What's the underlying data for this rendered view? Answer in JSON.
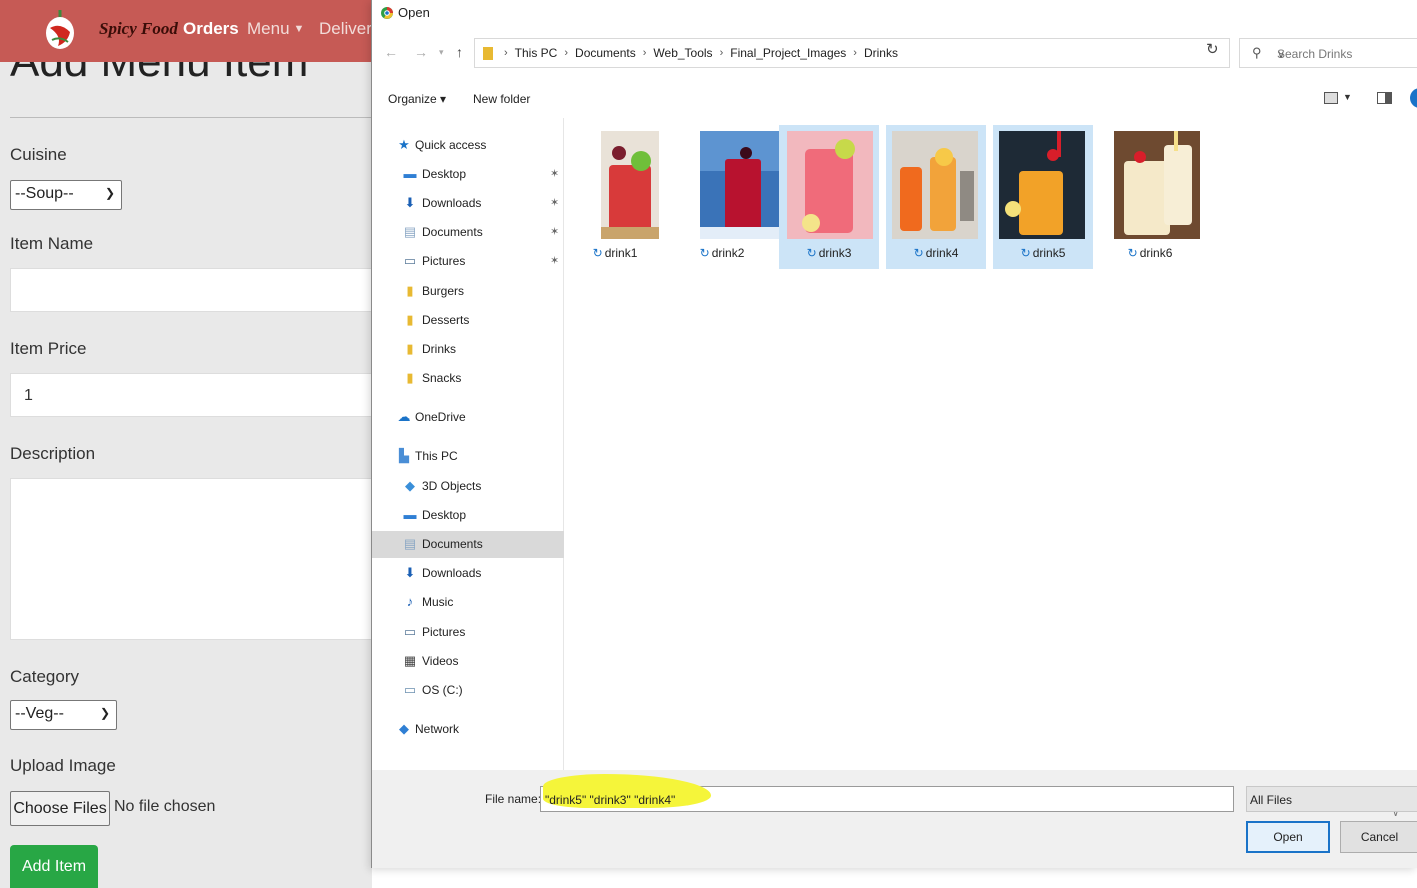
{
  "webpage": {
    "brand": "Spicy Food",
    "nav_orders": "Orders",
    "nav_menu": "Menu",
    "nav_delivery": "Delivery",
    "page_title": "Add Menu Item",
    "cuisine_label": "Cuisine",
    "cuisine_value": "--Soup--",
    "item_name_label": "Item Name",
    "item_name_value": "",
    "item_price_label": "Item Price",
    "item_price_value": "1",
    "description_label": "Description",
    "description_value": "",
    "category_label": "Category",
    "category_value": "--Veg--",
    "upload_label": "Upload Image",
    "choose_files": "Choose Files",
    "no_file": "No file chosen",
    "add_item": "Add Item",
    "colors": {
      "navbar": "#c65a55",
      "add_button": "#28a745"
    }
  },
  "dialog": {
    "title": "Open",
    "breadcrumb": [
      "This PC",
      "Documents",
      "Web_Tools",
      "Final_Project_Images",
      "Drinks"
    ],
    "search_placeholder": "Search Drinks",
    "toolbar": {
      "organize": "Organize ▾",
      "new_folder": "New folder"
    },
    "nav_items": [
      {
        "label": "Quick access",
        "icon": "star-icon"
      },
      {
        "label": "Desktop",
        "icon": "desktop-icon",
        "pinned": true
      },
      {
        "label": "Downloads",
        "icon": "download-icon",
        "pinned": true
      },
      {
        "label": "Documents",
        "icon": "documents-icon",
        "pinned": true
      },
      {
        "label": "Pictures",
        "icon": "pictures-icon",
        "pinned": true
      },
      {
        "label": "Burgers",
        "icon": "folder-icon"
      },
      {
        "label": "Desserts",
        "icon": "folder-icon"
      },
      {
        "label": "Drinks",
        "icon": "folder-icon"
      },
      {
        "label": "Snacks",
        "icon": "folder-icon"
      },
      {
        "label": "OneDrive",
        "icon": "cloud-icon"
      },
      {
        "label": "This PC",
        "icon": "computer-icon"
      },
      {
        "label": "3D Objects",
        "icon": "3d-objects-icon"
      },
      {
        "label": "Desktop",
        "icon": "desktop-icon"
      },
      {
        "label": "Documents",
        "icon": "documents-icon",
        "selected": true
      },
      {
        "label": "Downloads",
        "icon": "download-icon"
      },
      {
        "label": "Music",
        "icon": "music-icon"
      },
      {
        "label": "Pictures",
        "icon": "pictures-icon"
      },
      {
        "label": "Videos",
        "icon": "videos-icon"
      },
      {
        "label": "OS (C:)",
        "icon": "drive-icon"
      },
      {
        "label": "Network",
        "icon": "network-icon"
      }
    ],
    "files": [
      {
        "name": "drink1",
        "selected": false
      },
      {
        "name": "drink2",
        "selected": false
      },
      {
        "name": "drink3",
        "selected": true
      },
      {
        "name": "drink4",
        "selected": true
      },
      {
        "name": "drink5",
        "selected": true
      },
      {
        "name": "drink6",
        "selected": false
      }
    ],
    "file_name_label": "File name:",
    "file_name_value": "\"drink5\" \"drink3\" \"drink4\"",
    "file_type": "All Files",
    "open_button": "Open",
    "cancel_button": "Cancel",
    "colors": {
      "selection": "#cce4f7",
      "accent": "#1a73c8",
      "highlight": "#f5f53a"
    }
  }
}
